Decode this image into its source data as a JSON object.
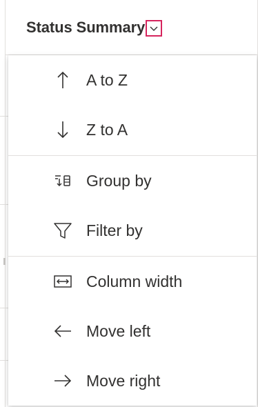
{
  "header": {
    "title": "Status Summary",
    "dropdown_icon": "chevron-down-icon",
    "highlight_color": "#d6245d"
  },
  "menu": {
    "sort_items": [
      {
        "label": "A to Z",
        "icon": "arrow-up-icon"
      },
      {
        "label": "Z to A",
        "icon": "arrow-down-icon"
      }
    ],
    "view_items": [
      {
        "label": "Group by",
        "icon": "group-by-icon"
      },
      {
        "label": "Filter by",
        "icon": "filter-icon"
      }
    ],
    "column_items": [
      {
        "label": "Column width",
        "icon": "column-width-icon"
      },
      {
        "label": "Move left",
        "icon": "arrow-left-icon"
      },
      {
        "label": "Move right",
        "icon": "arrow-right-icon"
      }
    ]
  }
}
